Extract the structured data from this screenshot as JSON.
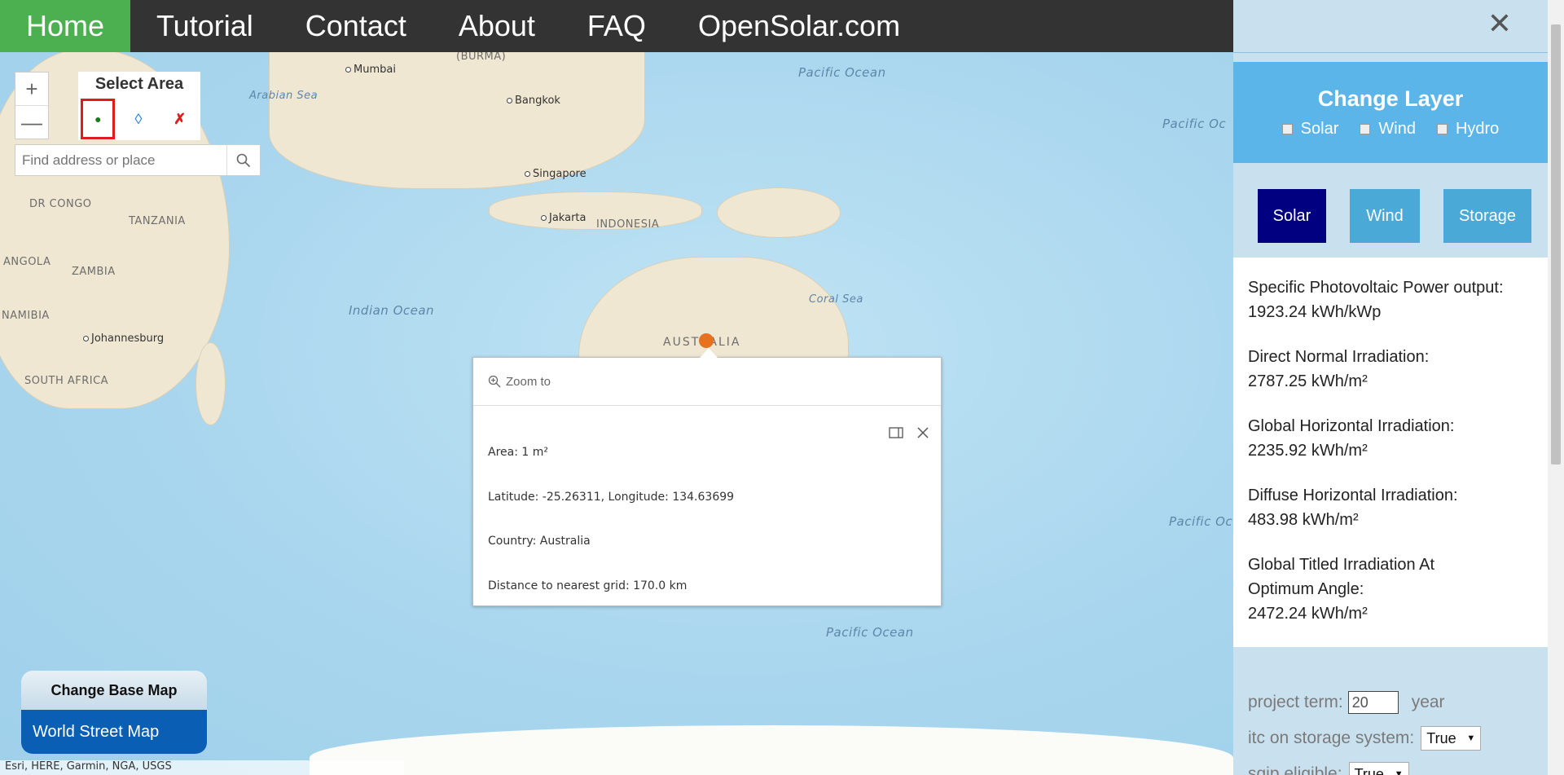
{
  "nav": {
    "items": [
      {
        "label": "Home",
        "active": true
      },
      {
        "label": "Tutorial"
      },
      {
        "label": "Contact"
      },
      {
        "label": "About"
      },
      {
        "label": "FAQ"
      },
      {
        "label": "OpenSolar.com"
      }
    ]
  },
  "map": {
    "zoom_in": "+",
    "zoom_out": "—",
    "select_area": {
      "title": "Select Area",
      "tools": [
        "point-tool",
        "polygon-tool",
        "clear-tool"
      ]
    },
    "search": {
      "placeholder": "Find address or place"
    },
    "labels": {
      "oceans": [
        "Pacific Ocean",
        "Arabian Sea",
        "Indian Ocean",
        "Coral Sea",
        "Pacific Ocean",
        "Pacific Oc",
        "Pacific Oc"
      ],
      "places": [
        "Mumbai",
        "Bangkok",
        "Singapore",
        "Jakarta",
        "Johannesburg",
        "(BURMA)"
      ],
      "countries": [
        "DR CONGO",
        "TANZANIA",
        "ANGOLA",
        "ZAMBIA",
        "NAMIBIA",
        "SOUTH AFRICA",
        "INDONESIA",
        "AUSTRALIA"
      ]
    },
    "popup": {
      "zoom_to": "Zoom to",
      "area": "Area: 1 m²",
      "coords": "Latitude: -25.26311, Longitude: 134.63699",
      "country": "Country: Australia",
      "grid": "Distance to nearest grid: 170.0 km"
    },
    "basemap": {
      "title": "Change Base Map",
      "current": "World Street Map"
    },
    "attribution": "Esri, HERE, Garmin, NGA, USGS"
  },
  "panel": {
    "close": "✕",
    "change_layer": {
      "title": "Change Layer",
      "options": [
        "Solar",
        "Wind",
        "Hydro"
      ]
    },
    "tabs": [
      {
        "label": "Solar",
        "active": true
      },
      {
        "label": "Wind"
      },
      {
        "label": "Storage"
      }
    ],
    "metrics": [
      {
        "label": "Specific Photovoltaic Power output:",
        "value": "1923.24 kWh/kWp"
      },
      {
        "label": "Direct Normal Irradiation:",
        "value": "2787.25 kWh/m²"
      },
      {
        "label": "Global Horizontal Irradiation:",
        "value": "2235.92 kWh/m²"
      },
      {
        "label": "Diffuse Horizontal Irradiation:",
        "value": "483.98 kWh/m²"
      },
      {
        "label": "Global Titled Irradiation At",
        "label2": "Optimum Angle:",
        "value": "2472.24 kWh/m²"
      }
    ],
    "config": {
      "project_term_label": "project term:",
      "project_term_value": "20",
      "project_term_unit": "year",
      "itc_label": "itc on storage system:",
      "itc_value": "True",
      "sgip_label": "sgip eligible:",
      "sgip_value": "True"
    }
  },
  "colors": {
    "nav_bg": "#333333",
    "nav_active": "#4caf50",
    "layer_header": "#5bb5e8",
    "tab_active": "#000080",
    "tab_inactive": "#4aa9d6",
    "basemap_btn": "#0a5fb4"
  }
}
